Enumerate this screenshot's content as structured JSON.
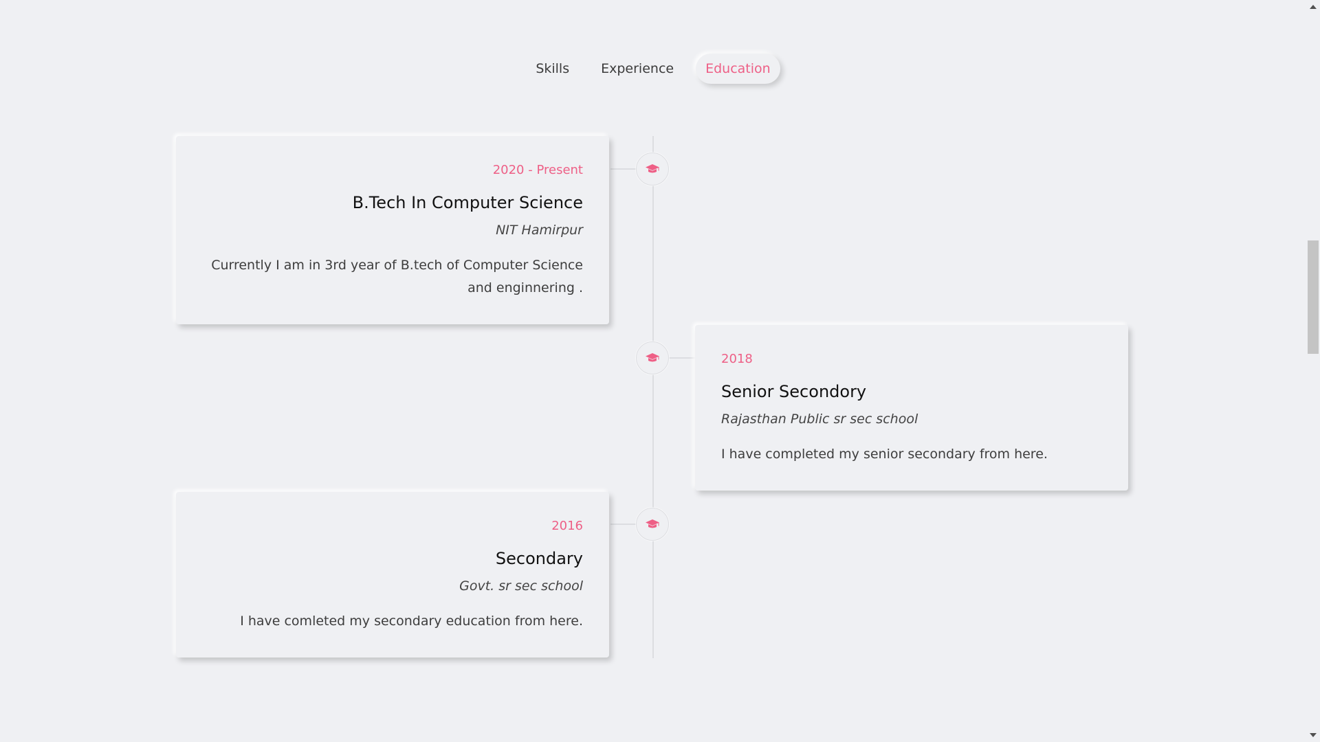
{
  "tabs": [
    {
      "label": "Skills",
      "active": false
    },
    {
      "label": "Experience",
      "active": false
    },
    {
      "label": "Education",
      "active": true
    }
  ],
  "colors": {
    "accent": "#ee5f86",
    "background": "#eff0f3",
    "line": "#dcdde1"
  },
  "education": [
    {
      "date": "2020 - Present",
      "title": "B.Tech In Computer Science",
      "school": "NIT Hamirpur",
      "description": "Currently I am in 3rd year of B.tech of Computer Science and enginnering .",
      "side": "left",
      "icon": "graduation-cap-icon"
    },
    {
      "date": "2018",
      "title": "Senior Secondory",
      "school": "Rajasthan Public sr sec school",
      "description": "I have completed my senior secondary from here.",
      "side": "right",
      "icon": "graduation-cap-icon"
    },
    {
      "date": "2016",
      "title": "Secondary",
      "school": "Govt. sr sec school",
      "description": "I have comleted my secondary education from here.",
      "side": "left",
      "icon": "graduation-cap-icon"
    }
  ]
}
